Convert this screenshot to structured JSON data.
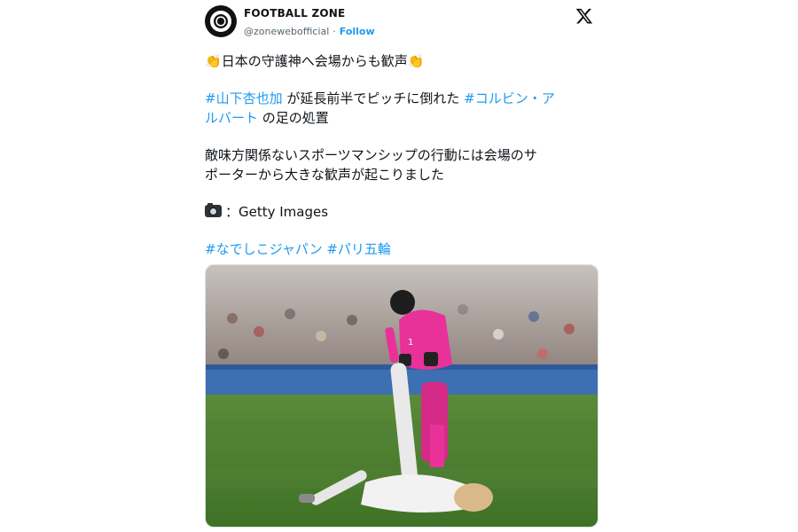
{
  "author": {
    "name": "FOOTBALL ZONE",
    "handle": "@zonewebofficial",
    "separator": "·",
    "follow_label": "Follow"
  },
  "tweet": {
    "line1": "日本の守護神へ会場からも歓声",
    "line1_emoji_left": "👏",
    "line1_emoji_right": "👏",
    "line2_tag1": "#山下杏也加",
    "line2_text": " が延長前半でピッチに倒れた ",
    "line2_tag2": "#コルビン・ア",
    "line3_tag2_cont": "ルバート",
    "line3_text": " の足の処置",
    "line4": "敵味方関係ないスポーツマンシップの行動には会場のサ",
    "line5": "ポーターから大きな歓声が起こりました",
    "credit": "：Getty Images",
    "hashtag1": "#なでしこジャパン",
    "hashtag2": "#パリ五輪"
  },
  "icons": {
    "brand": "x-logo-icon",
    "camera": "camera-icon",
    "clap": "clapping-hands-icon"
  },
  "colors": {
    "link": "#1d9bf0",
    "text": "#0f1419",
    "muted": "#536471"
  },
  "photo": {
    "jersey_number": "1"
  }
}
